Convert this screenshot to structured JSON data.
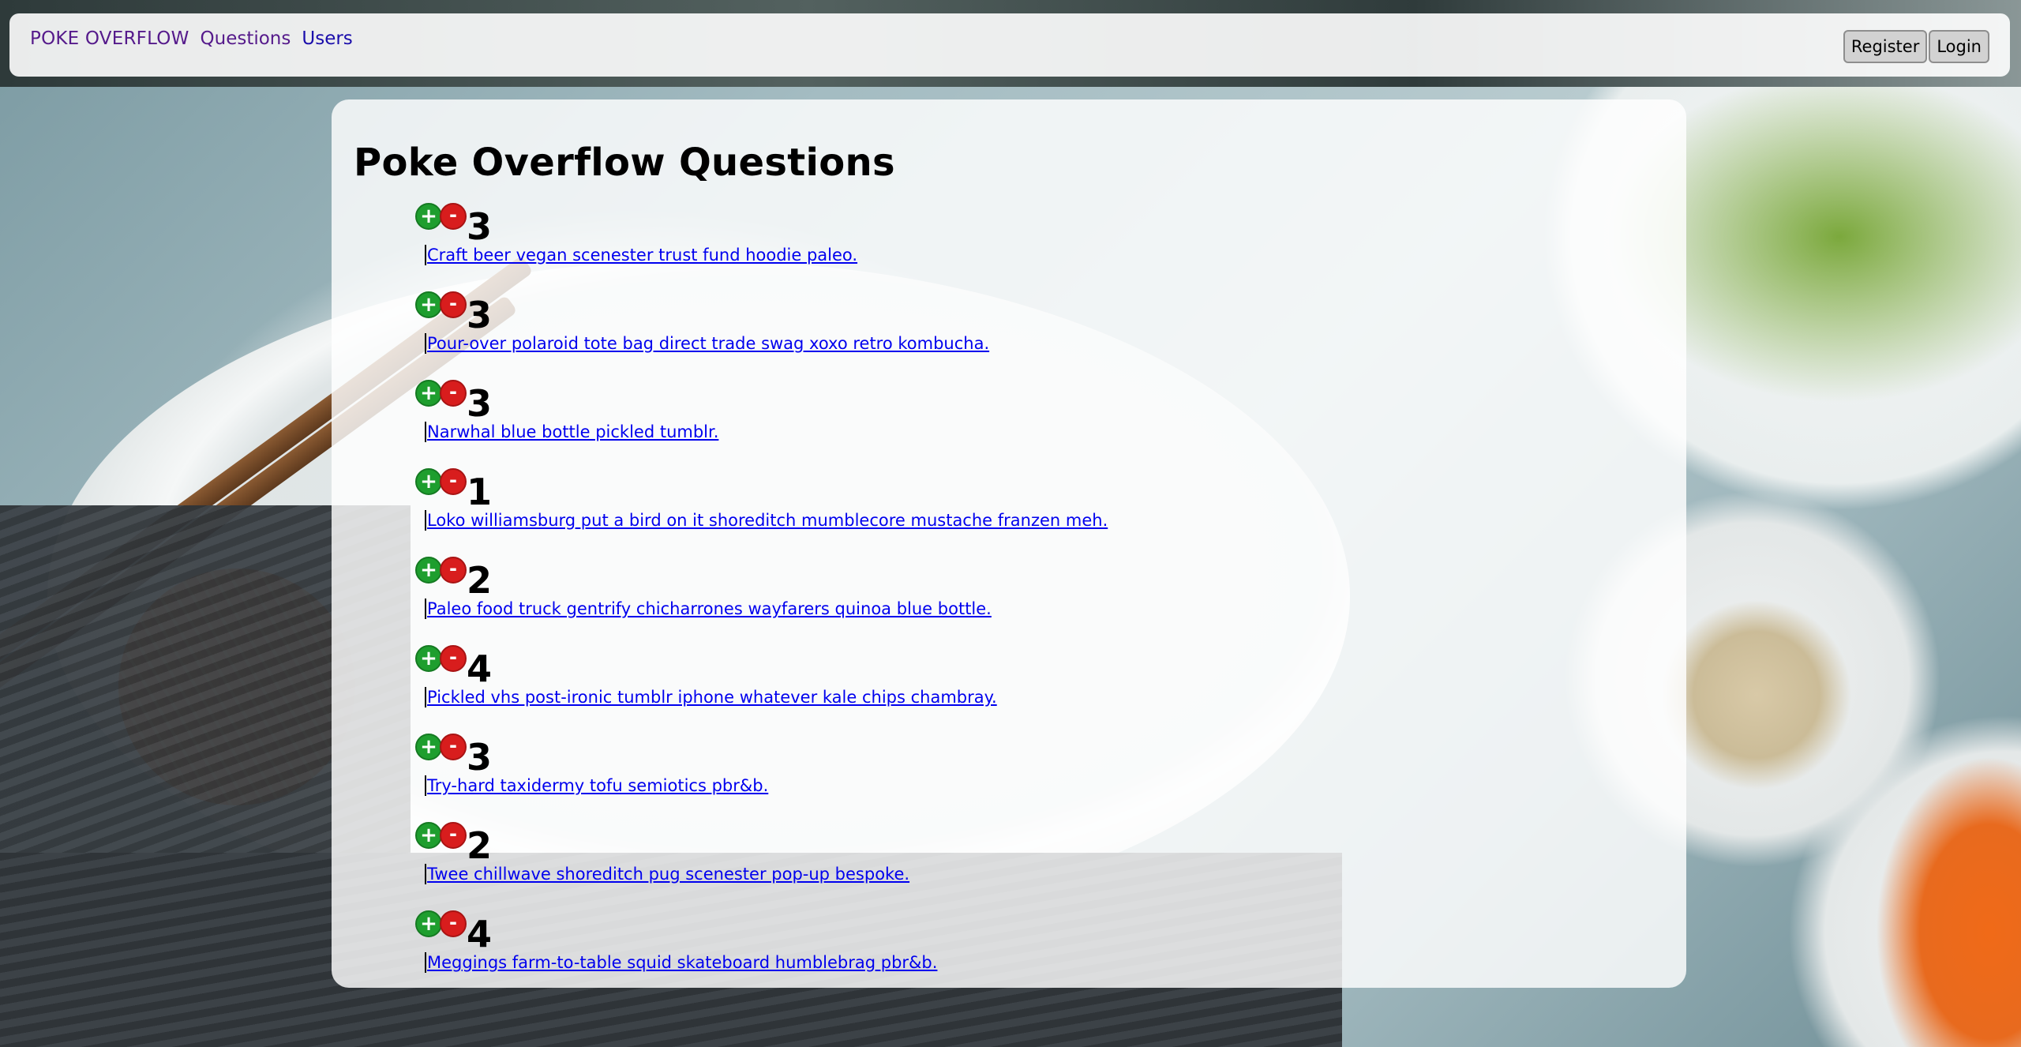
{
  "navbar": {
    "brand": "POKE OVERFLOW",
    "links": [
      "Questions",
      "Users"
    ],
    "register_label": "Register",
    "login_label": "Login"
  },
  "main": {
    "title": "Poke Overflow Questions",
    "questions": [
      {
        "votes": "3",
        "text": "Craft beer vegan scenester trust fund hoodie paleo."
      },
      {
        "votes": "3",
        "text": "Pour-over polaroid tote bag direct trade swag xoxo retro kombucha."
      },
      {
        "votes": "3",
        "text": "Narwhal blue bottle pickled tumblr."
      },
      {
        "votes": "1",
        "text": "Loko williamsburg put a bird on it shoreditch mumblecore mustache franzen meh."
      },
      {
        "votes": "2",
        "text": "Paleo food truck gentrify chicharrones wayfarers quinoa blue bottle."
      },
      {
        "votes": "4",
        "text": "Pickled vhs post-ironic tumblr iphone whatever kale chips chambray."
      },
      {
        "votes": "3",
        "text": "Try-hard taxidermy tofu semiotics pbr&b."
      },
      {
        "votes": "2",
        "text": "Twee chillwave shoreditch pug scenester pop-up bespoke."
      },
      {
        "votes": "4",
        "text": "Meggings farm-to-table squid skateboard humblebrag pbr&b."
      }
    ],
    "upvote_symbol": "+",
    "downvote_symbol": "-"
  }
}
